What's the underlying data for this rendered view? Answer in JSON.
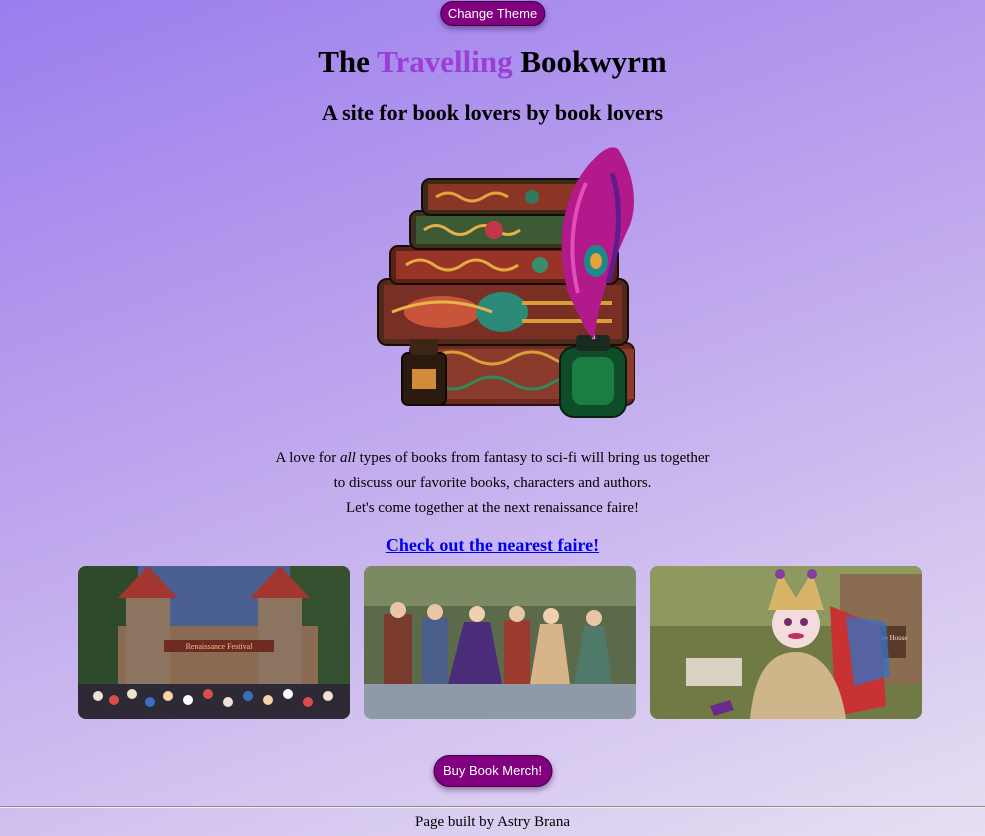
{
  "header": {
    "theme_button": "Change Theme",
    "title_before": "The ",
    "title_accent": "Travelling",
    "title_after": " Bookwyrm",
    "subtitle": "A site for book lovers by book lovers"
  },
  "intro": {
    "line1_before": "A love for ",
    "line1_emphasis": "all",
    "line1_after": " types of books from fantasy to sci-fi will bring us together",
    "line2": "to discuss our favorite books, characters and authors.",
    "line3": "Let's come together at the next renaissance faire!"
  },
  "faire_link": "Check out the nearest faire!",
  "photo_texts": {
    "festival_banner": "Renaissance Festival",
    "house_sign": "Royal Coffee House"
  },
  "merch_button": "Buy Book Merch!",
  "footer": "Page built by Astry Brana",
  "colors": {
    "accent": "#9b3dd6",
    "button": "#800080",
    "link": "#0000ee"
  }
}
